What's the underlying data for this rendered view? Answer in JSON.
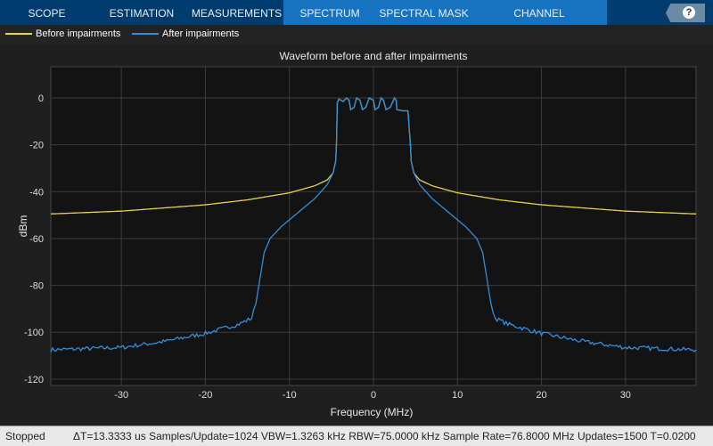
{
  "tabs": [
    {
      "label": "SCOPE",
      "active": false
    },
    {
      "label": "ESTIMATION",
      "active": false
    },
    {
      "label": "MEASUREMENTS",
      "active": false
    },
    {
      "label": "SPECTRUM",
      "active": true
    },
    {
      "label": "SPECTRAL MASK",
      "active": true
    },
    {
      "label": "CHANNEL MEASUREMENTS",
      "active": true
    }
  ],
  "help_label": "?",
  "legend": [
    {
      "label": "Before impairments",
      "color": "#e8d24a"
    },
    {
      "label": "After impairments",
      "color": "#2f8fdc"
    }
  ],
  "status": {
    "state": "Stopped",
    "info": "ΔT=13.3333 us  Samples/Update=1024  VBW=1.3263 kHz  RBW=75.0000 kHz  Sample Rate=76.8000 MHz  Updates=1500  T=0.0200"
  },
  "chart_data": {
    "type": "line",
    "title": "Waveform before and after impairments",
    "xlabel": "Frequency (MHz)",
    "ylabel": "dBm",
    "xlim": [
      -38.4,
      38.4
    ],
    "ylim": [
      -122.7,
      13.3
    ],
    "xticks": [
      -30,
      -20,
      -10,
      0,
      10,
      20,
      30
    ],
    "yticks": [
      0,
      -20,
      -40,
      -60,
      -80,
      -100,
      -120
    ],
    "grid": true,
    "legend_position": "top",
    "inband": [
      [
        -4.4,
        -20
      ],
      [
        -4.3,
        -2
      ],
      [
        -4.1,
        -0.5
      ],
      [
        -3.6,
        -1.5
      ],
      [
        -3.2,
        0
      ],
      [
        -2.9,
        -1
      ],
      [
        -2.7,
        -5
      ],
      [
        -2.3,
        -4
      ],
      [
        -2.0,
        0
      ],
      [
        -1.6,
        -1
      ],
      [
        -1.3,
        -5
      ],
      [
        -0.9,
        -4
      ],
      [
        -0.5,
        0
      ],
      [
        0,
        -1
      ],
      [
        0.2,
        -5
      ],
      [
        0.6,
        -4
      ],
      [
        0.9,
        0
      ],
      [
        1.2,
        -1
      ],
      [
        1.5,
        -5
      ],
      [
        2.0,
        -4
      ],
      [
        2.5,
        0
      ],
      [
        2.7,
        -1
      ],
      [
        2.8,
        -5
      ],
      [
        3.5,
        -5.5
      ],
      [
        4.1,
        -5.5
      ],
      [
        4.3,
        -15
      ],
      [
        4.4,
        -20
      ]
    ],
    "series": [
      {
        "name": "Before impairments",
        "color": "#e8d24a",
        "points": [
          [
            -38.4,
            -49.5
          ],
          [
            -30,
            -48.3
          ],
          [
            -20,
            -45.6
          ],
          [
            -15,
            -43.5
          ],
          [
            -10,
            -40.5
          ],
          [
            -7,
            -37.5
          ],
          [
            -5.5,
            -35
          ],
          [
            -4.8,
            -32
          ],
          [
            -4.5,
            -27
          ]
        ]
      },
      {
        "name": "After impairments",
        "color": "#2f8fdc",
        "points": [
          [
            -38.4,
            -107.5
          ],
          [
            -30,
            -106.5
          ],
          [
            -25,
            -104
          ],
          [
            -20,
            -100.5
          ],
          [
            -16,
            -96.5
          ],
          [
            -14.5,
            -94
          ],
          [
            -14,
            -88
          ],
          [
            -13.5,
            -77
          ],
          [
            -13,
            -66
          ],
          [
            -12.3,
            -60
          ],
          [
            -11,
            -55
          ],
          [
            -9,
            -49
          ],
          [
            -7,
            -43
          ],
          [
            -5.5,
            -37
          ],
          [
            -4.8,
            -32
          ],
          [
            -4.5,
            -27
          ]
        ]
      }
    ]
  }
}
